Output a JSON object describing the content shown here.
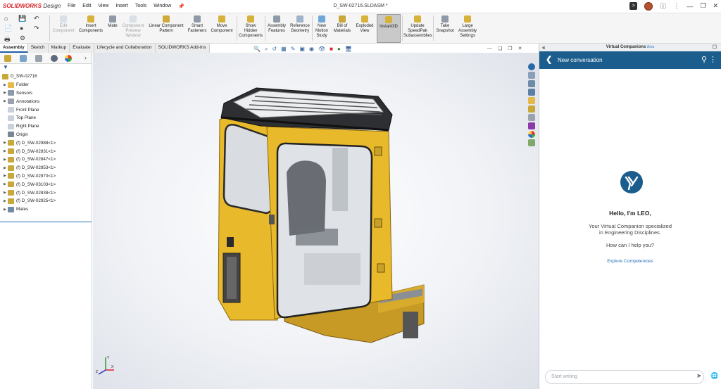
{
  "app": {
    "brand_main": "SOLIDWORKS",
    "brand_sub": " Design",
    "document_title": "D_SW-02716.SLDASM *"
  },
  "menu": [
    "File",
    "Edit",
    "View",
    "Insert",
    "Tools",
    "Window"
  ],
  "toolbar": {
    "edit_component": "Edit\nComponent",
    "insert_components": "Insert\nComponents",
    "mate": "Mate",
    "component_preview": "Component\nPreview\nWindow",
    "linear_pattern": "Linear Component\nPattern",
    "smart_fasteners": "Smart\nFasteners",
    "move_component": "Move\nComponent",
    "show_hidden": "Show\nHidden\nComponents",
    "assembly_features": "Assembly\nFeatures",
    "reference_geometry": "Reference\nGeometry",
    "new_motion_study": "New\nMotion\nStudy",
    "bill_of_materials": "Bill of\nMaterials",
    "exploded_view": "Exploded\nView",
    "instant3d": "Instant3D",
    "update_speedpak": "Update\nSpeedPak\nSubassemblies",
    "take_snapshot": "Take\nSnapshot",
    "large_assembly": "Large\nAssembly\nSettings"
  },
  "tabs": [
    "Assembly",
    "Sketch",
    "Markup",
    "Evaluate",
    "Lifecycle and Collaboration",
    "SOLIDWORKS Add-Ins"
  ],
  "tree": {
    "root": "D_SW-02716",
    "items": [
      {
        "label": "Folder",
        "icon": "folder-icon",
        "color": "#e8b84a"
      },
      {
        "label": "Sensors",
        "icon": "sensor-icon",
        "color": "#8a9aa8"
      },
      {
        "label": "Annotations",
        "icon": "annotation-icon",
        "color": "#9aa3ad"
      },
      {
        "label": "Front Plane",
        "icon": "plane-icon",
        "color": "#c9d2dc"
      },
      {
        "label": "Top Plane",
        "icon": "plane-icon",
        "color": "#c9d2dc"
      },
      {
        "label": "Right Plane",
        "icon": "plane-icon",
        "color": "#c9d2dc"
      },
      {
        "label": "Origin",
        "icon": "origin-icon",
        "color": "#7b8794"
      },
      {
        "label": "(f) D_SW-02988<1>",
        "icon": "part-icon",
        "color": "#c9a83a"
      },
      {
        "label": "(f) D_SW-02831<1>",
        "icon": "part-icon",
        "color": "#c9a83a"
      },
      {
        "label": "(f) D_SW-02847<1>",
        "icon": "part-icon",
        "color": "#c9a83a"
      },
      {
        "label": "(f) D_SW-02853<1>",
        "icon": "part-icon",
        "color": "#c9a83a"
      },
      {
        "label": "(f) D_SW-02970<1>",
        "icon": "part-icon",
        "color": "#c9a83a"
      },
      {
        "label": "(f) D_SW-03103<1>",
        "icon": "part-icon",
        "color": "#c9a83a"
      },
      {
        "label": "(f) D_SW-02838<1>",
        "icon": "part-icon",
        "color": "#c9a83a"
      },
      {
        "label": "(f) D_SW-02925<1>",
        "icon": "part-icon",
        "color": "#c9a83a"
      },
      {
        "label": "Mates",
        "icon": "mates-icon",
        "color": "#6f8ba6"
      }
    ]
  },
  "viewport": {
    "triad_x": "X",
    "triad_y": "Y",
    "triad_z": "Z"
  },
  "companion": {
    "panel_title": "Virtual Companions",
    "beta": "Beta",
    "nav_title": "New conversation",
    "greeting": "Hello, I'm LEO,",
    "description_1": "Your Virtual Companion specialized",
    "description_2": "in Engineering Disciplines.",
    "help_text": "How can I help you?",
    "explore_link": "Explore Competencies",
    "input_placeholder": "Start writing"
  },
  "colors": {
    "accent": "#1b5d8c",
    "brand": "#d8232a",
    "link": "#1f6fb6",
    "cab_yellow": "#e8b92a"
  }
}
